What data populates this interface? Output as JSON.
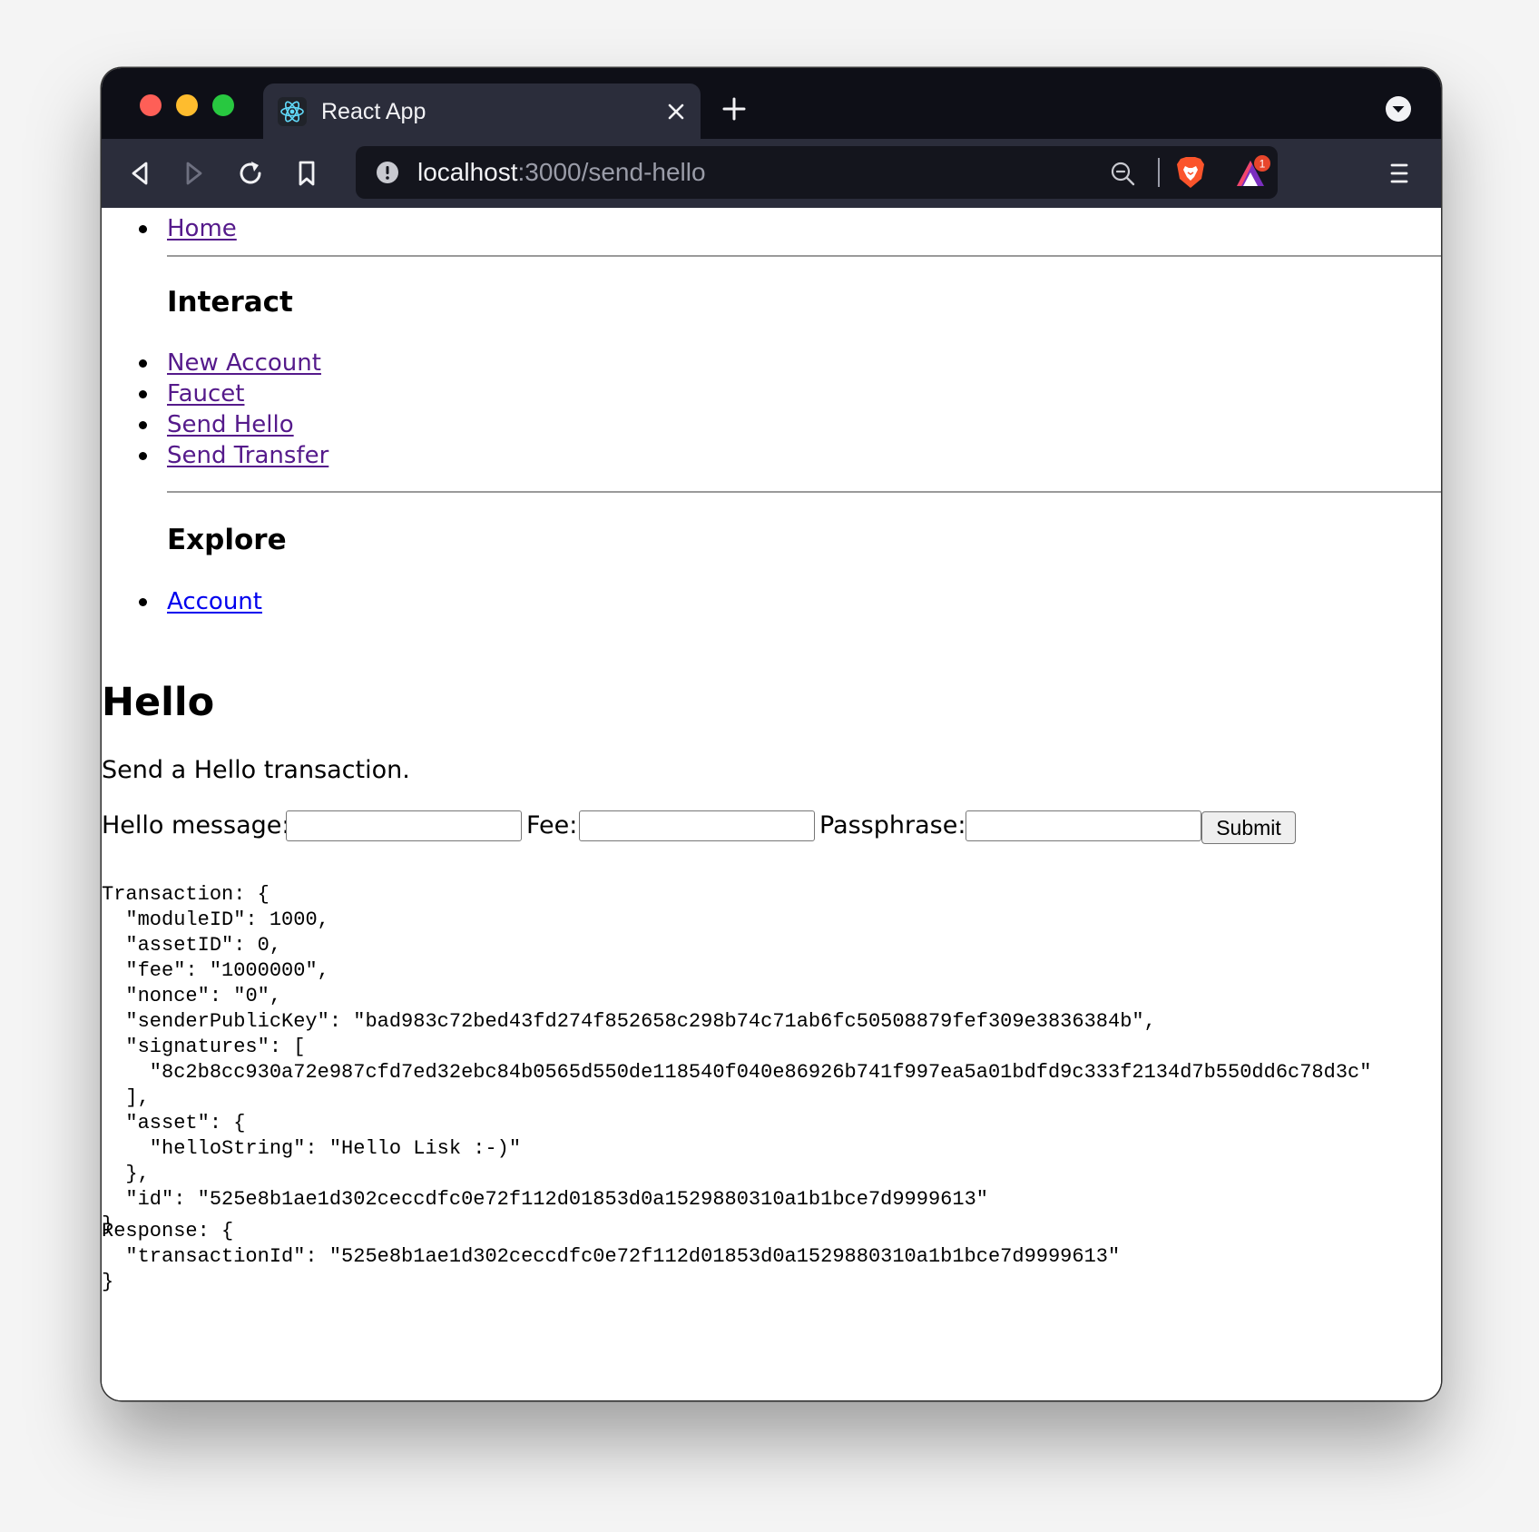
{
  "browser": {
    "tab_title": "React App",
    "url_host": "localhost",
    "url_path": ":3000/send-hello",
    "rewards_badge": "1"
  },
  "nav": {
    "home_label": "Home",
    "interact_heading": "Interact",
    "interact_links": [
      "New Account",
      "Faucet",
      "Send Hello",
      "Send Transfer"
    ],
    "explore_heading": "Explore",
    "explore_links": [
      "Account"
    ]
  },
  "page": {
    "title": "Hello",
    "description": "Send a Hello transaction."
  },
  "form": {
    "hello_message_label": "Hello message:",
    "hello_message_value": "",
    "fee_label": "Fee:",
    "fee_value": "",
    "passphrase_label": "Passphrase:",
    "passphrase_value": "",
    "submit_label": "Submit"
  },
  "transaction": {
    "label": "Transaction",
    "moduleID": 1000,
    "assetID": 0,
    "fee": "1000000",
    "nonce": "0",
    "senderPublicKey": "bad983c72bed43fd274f852658c298b74c71ab6fc50508879fef309e3836384b",
    "signatures": [
      "8c2b8cc930a72e987cfd7ed32ebc84b0565d550de118540f040e86926b741f997ea5a01bdfd9c333f2134d7b550dd6c78d3c"
    ],
    "asset": {
      "helloString": "Hello Lisk :-)"
    },
    "id": "525e8b1ae1d302ceccdfc0e72f112d01853d0a1529880310a1b1bce7d9999613"
  },
  "response": {
    "label": "Response",
    "transactionId": "525e8b1ae1d302ceccdfc0e72f112d01853d0a1529880310a1b1bce7d9999613"
  },
  "colors": {
    "tabbar_bg": "#0e0f17",
    "toolbar_bg": "#2b2d3b",
    "visited_link": "#551a8b",
    "unvisited_link": "#0000ee"
  },
  "icons": {
    "favicon": "react-icon",
    "back": "back-arrow-icon",
    "forward": "forward-arrow-icon",
    "reload": "reload-icon",
    "bookmark": "bookmark-icon",
    "site_info": "info-icon",
    "zoom": "zoom-out-icon",
    "shields": "brave-shields-icon",
    "rewards": "brave-rewards-icon",
    "menu": "hamburger-menu-icon"
  }
}
